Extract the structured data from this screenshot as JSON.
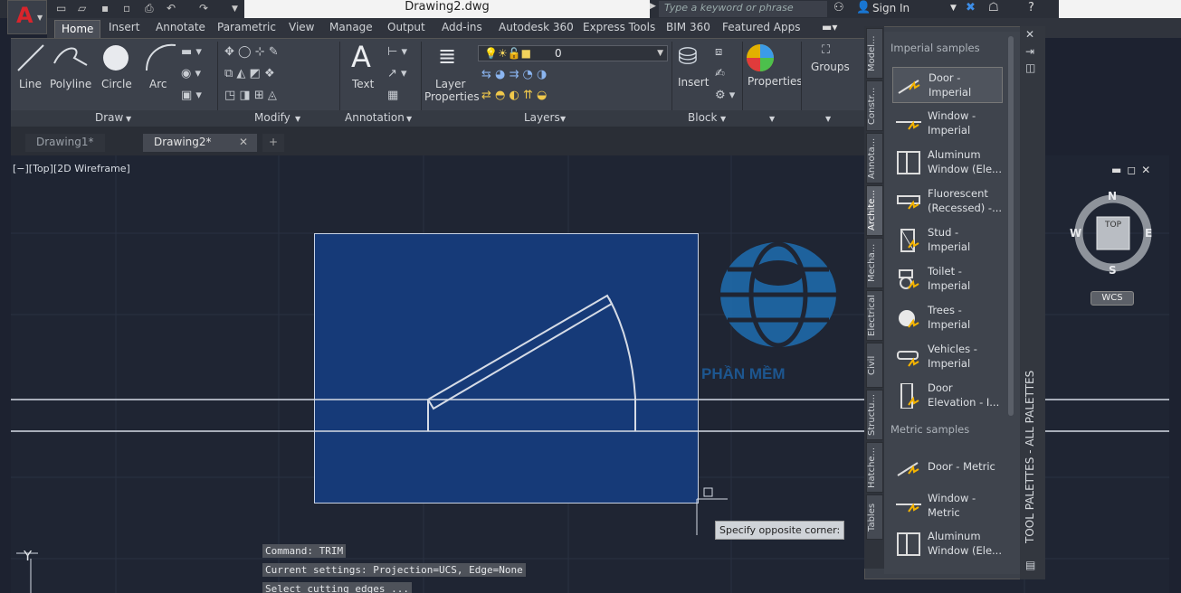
{
  "window": {
    "title": "Drawing2.dwg",
    "search_placeholder": "Type a keyword or phrase",
    "sign_in": "Sign In"
  },
  "ribbon": {
    "tabs": [
      "Home",
      "Insert",
      "Annotate",
      "Parametric",
      "View",
      "Manage",
      "Output",
      "Add-ins",
      "Autodesk 360",
      "Express Tools",
      "BIM 360",
      "Featured Apps"
    ],
    "draw_tools": [
      "Line",
      "Polyline",
      "Circle",
      "Arc"
    ],
    "text_label": "Text",
    "layer_properties": [
      "Layer",
      "Properties"
    ],
    "layer_value": "0",
    "insert_label": "Insert",
    "properties_label": "Properties",
    "groups_label": "Groups",
    "panels": [
      "Draw",
      "Modify",
      "Annotation",
      "Layers",
      "Block"
    ]
  },
  "doc_tabs": [
    "Drawing1*",
    "Drawing2*"
  ],
  "viewport": {
    "label": "[−][Top][2D Wireframe]",
    "watermark": "PHẦN MỀM",
    "compass": {
      "n": "N",
      "s": "S",
      "e": "E",
      "w": "W",
      "top": "TOP"
    },
    "ucs": "WCS",
    "axis_y": "Y",
    "tooltip": "Specify opposite corner:"
  },
  "command_history": [
    "Command: TRIM",
    "Current settings: Projection=UCS, Edge=None",
    "Select cutting edges ..."
  ],
  "palette": {
    "title": "TOOL PALETTES - ALL PALETTES",
    "tabs": [
      "Model...",
      "Constr...",
      "Annota...",
      "Archite...",
      "Mecha...",
      "Electrical",
      "Civil",
      "Structu...",
      "Hatche...",
      "Tables"
    ],
    "imperial_header": "Imperial samples",
    "metric_header": "Metric samples",
    "imperial_items": [
      [
        "Door -",
        "Imperial"
      ],
      [
        "Window -",
        "Imperial"
      ],
      [
        "Aluminum",
        "Window (Ele..."
      ],
      [
        "Fluorescent",
        "(Recessed) -..."
      ],
      [
        "Stud -",
        "Imperial"
      ],
      [
        "Toilet -",
        "Imperial"
      ],
      [
        "Trees -",
        "Imperial"
      ],
      [
        "Vehicles -",
        "Imperial"
      ],
      [
        "Door",
        "Elevation - I..."
      ]
    ],
    "metric_items": [
      [
        "Door - Metric",
        ""
      ],
      [
        "Window -",
        "Metric"
      ],
      [
        "Aluminum",
        "Window (Ele..."
      ]
    ]
  },
  "colors": {
    "accent_red": "#d8252c",
    "selection_fill": "#163a78",
    "viewport_bg": "#1f2533"
  }
}
